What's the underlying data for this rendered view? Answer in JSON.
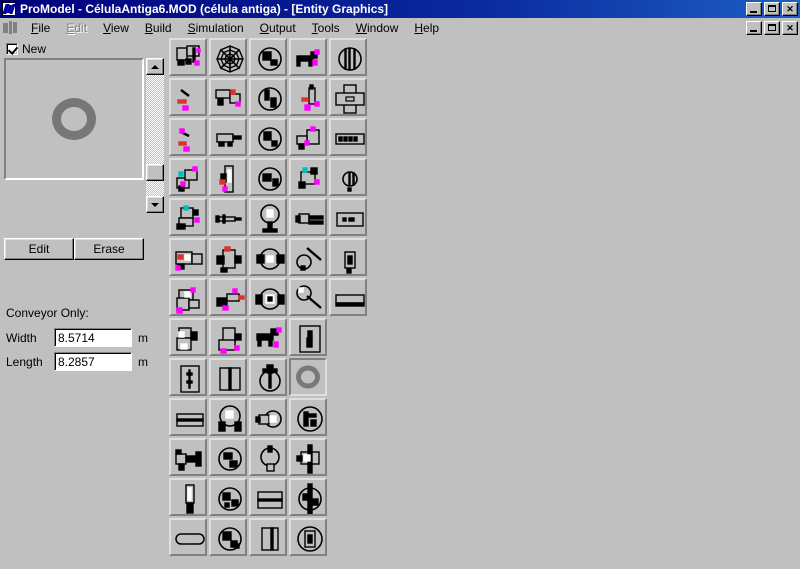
{
  "window": {
    "app_name": "ProModel",
    "title": "ProModel - CélulaAntiga6.MOD (célula antiga) - [Entity Graphics]",
    "document_name": "CélulaAntiga6.MOD",
    "model_label": "célula antiga",
    "child_window_title": "Entity Graphics",
    "app_icon": "promodel-icon",
    "mdi_icon": "mdi-document-icon",
    "controls": {
      "minimize": "minimize-button",
      "maximize": "restore-button",
      "close": "close-button",
      "close_glyph": "✕"
    }
  },
  "menu": {
    "items": [
      {
        "label": "File",
        "mnemonic": "F",
        "disabled": false
      },
      {
        "label": "Edit",
        "mnemonic": "E",
        "disabled": true
      },
      {
        "label": "View",
        "mnemonic": "V",
        "disabled": false
      },
      {
        "label": "Build",
        "mnemonic": "B",
        "disabled": false
      },
      {
        "label": "Simulation",
        "mnemonic": "S",
        "disabled": false
      },
      {
        "label": "Output",
        "mnemonic": "O",
        "disabled": false
      },
      {
        "label": "Tools",
        "mnemonic": "T",
        "disabled": false
      },
      {
        "label": "Window",
        "mnemonic": "W",
        "disabled": false
      },
      {
        "label": "Help",
        "mnemonic": "H",
        "disabled": false
      }
    ]
  },
  "panel": {
    "new_checkbox": {
      "label": "New",
      "checked": true
    },
    "preview": {
      "graphic": "gray-ring-graphic"
    },
    "scrollbar": {
      "up": "scroll-up-button",
      "down": "scroll-down-button",
      "thumb": "scroll-thumb"
    },
    "buttons": {
      "edit": "Edit",
      "erase": "Erase"
    },
    "conveyor": {
      "section_label": "Conveyor Only:",
      "width_label": "Width",
      "width_value": "8.5714",
      "width_unit": "m",
      "length_label": "Length",
      "length_value": "8.2857",
      "length_unit": "m"
    }
  },
  "graphics_grid": {
    "columns": 5,
    "cell_size": 38,
    "cell_pitch": 40,
    "selected_index": 43,
    "selected_name": "gray-ring-graphic",
    "rows": [
      [
        "forklift-truck",
        "spider-web",
        "globe-wedge",
        "dog-figure",
        "barrel-capsule"
      ],
      [
        "tool-wrench",
        "machine-cluster",
        "globe-split",
        "bottle-tool",
        "cross-pallet"
      ],
      [
        "tool-brush",
        "conveyor-feeder",
        "globe-cut",
        "workstation-box",
        "label-plate"
      ],
      [
        "machine-stack",
        "tall-cabinet",
        "globe-quarter",
        "machine-arm",
        "pill-capsule"
      ],
      [
        "robot-head",
        "syringe",
        "fan-tower",
        "clamp-tool",
        "card-reader"
      ],
      [
        "control-panel",
        "press-machine",
        "spool-winder",
        "hand-tool",
        "small-switch"
      ],
      [
        "cabinet-unit",
        "spray-gun",
        "motor-rotor",
        "magnifier-tool",
        "tray-bin"
      ],
      [
        "rack-unit",
        "robot-column",
        "animal-figure",
        "person-placard"
      ],
      [
        "panel-door",
        "double-door",
        "balloon-valve",
        "gray-ring-graphic"
      ],
      [
        "two-drawer",
        "globe-bracket",
        "capsule-pair",
        "circle-clock"
      ],
      [
        "megaphone",
        "globe-swirl",
        "light-bulb",
        "gate-valve"
      ],
      [
        "knife-blade",
        "globe-dotted",
        "box-layers",
        "spindle-valve"
      ],
      [
        "oval-tray",
        "globe-arrow",
        "book-box",
        "circle-gauge"
      ]
    ]
  },
  "colors": {
    "titlebar_start": "#00007b",
    "titlebar_end": "#1d5fc4",
    "face": "#c0c0c0",
    "shadow": "#808080",
    "highlight": "#ffffff",
    "field_bg": "#ffffff",
    "ring_gray": "#777777",
    "accent_magenta": "#ff00ff"
  }
}
